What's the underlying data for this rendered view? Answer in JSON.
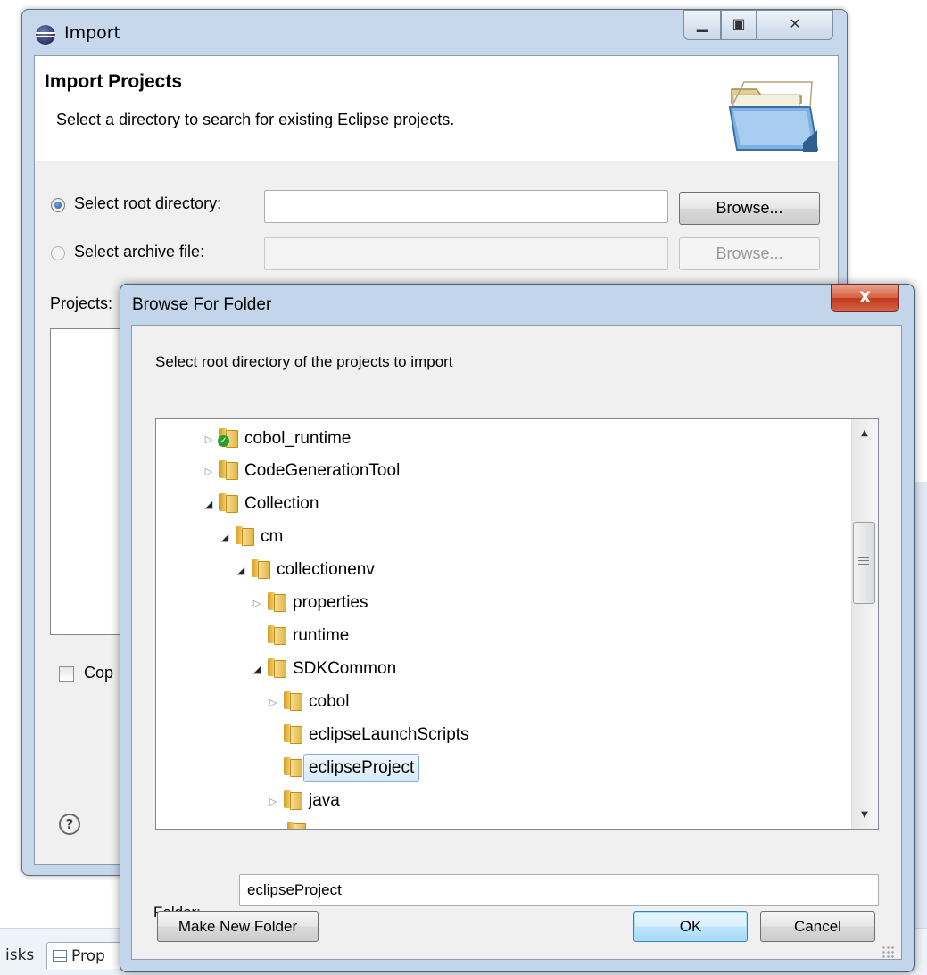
{
  "background": {
    "tabs": [
      {
        "label": "isks"
      },
      {
        "label": "Prop"
      }
    ]
  },
  "import_window": {
    "title": "Import",
    "header": {
      "title": "Import Projects",
      "description": "Select a directory to search for existing Eclipse projects."
    },
    "root_directory": {
      "label": "Select root directory:",
      "value": "",
      "selected": true,
      "browse_label": "Browse..."
    },
    "archive_file": {
      "label": "Select archive file:",
      "value": "",
      "selected": false,
      "browse_label": "Browse..."
    },
    "projects_label": "Projects:",
    "copy_label": "Cop",
    "help_glyph": "?"
  },
  "browse_dialog": {
    "title": "Browse For Folder",
    "close_glyph": "X",
    "description": "Select root directory of the projects to import",
    "tree": [
      {
        "label": "cobol_runtime",
        "depth": 0,
        "arrow": "collapsed",
        "icon": "shared-folder-icon"
      },
      {
        "label": "CodeGenerationTool",
        "depth": 0,
        "arrow": "collapsed",
        "icon": "folder-icon"
      },
      {
        "label": "Collection",
        "depth": 0,
        "arrow": "expanded",
        "icon": "folder-icon"
      },
      {
        "label": "cm",
        "depth": 1,
        "arrow": "expanded",
        "icon": "folder-icon"
      },
      {
        "label": "collectionenv",
        "depth": 2,
        "arrow": "expanded",
        "icon": "folder-icon"
      },
      {
        "label": "properties",
        "depth": 3,
        "arrow": "collapsed",
        "icon": "folder-icon"
      },
      {
        "label": "runtime",
        "depth": 3,
        "arrow": "none",
        "icon": "folder-icon"
      },
      {
        "label": "SDKCommon",
        "depth": 3,
        "arrow": "expanded",
        "icon": "folder-icon"
      },
      {
        "label": "cobol",
        "depth": 4,
        "arrow": "collapsed",
        "icon": "folder-icon"
      },
      {
        "label": "eclipseLaunchScripts",
        "depth": 4,
        "arrow": "none",
        "icon": "folder-icon"
      },
      {
        "label": "eclipseProject",
        "depth": 4,
        "arrow": "none",
        "icon": "folder-icon",
        "selected": true
      },
      {
        "label": "java",
        "depth": 4,
        "arrow": "collapsed",
        "icon": "folder-icon"
      }
    ],
    "scrollbar": {
      "up_glyph": "▲",
      "down_glyph": "▼"
    },
    "folder_label": "Folder:",
    "folder_value": "eclipseProject",
    "make_new_folder_label": "Make New Folder",
    "ok_label": "OK",
    "cancel_label": "Cancel"
  }
}
